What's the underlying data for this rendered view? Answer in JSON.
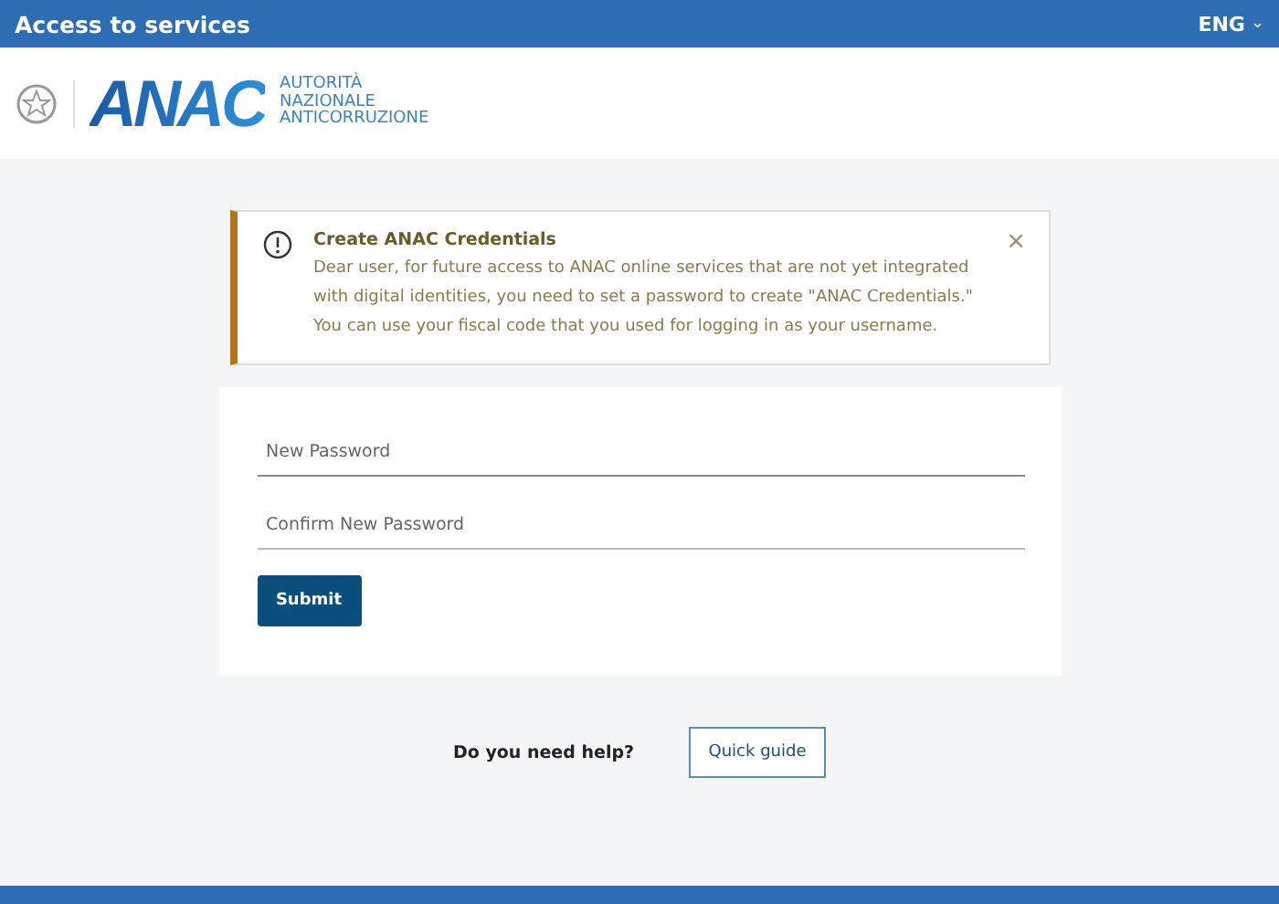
{
  "header": {
    "title": "Access to services",
    "language": "ENG",
    "language_caret": "⌄"
  },
  "brand": {
    "logo_text": "ANAC",
    "tagline": [
      "AUTORITÀ",
      "NAZIONALE",
      "ANTICORRUZIONE"
    ]
  },
  "alert": {
    "title": "Create ANAC Credentials",
    "message": "Dear user, for future access to ANAC online services that are not yet integrated with digital identities, you need to set a password to create \"ANAC Credentials.\" You can use your fiscal code that you used for logging in as your username.",
    "close": "×"
  },
  "form": {
    "fields": [
      {
        "placeholder": "New Password"
      },
      {
        "placeholder": "Confirm New Password"
      }
    ],
    "submit": "Submit"
  },
  "help": {
    "question": "Do you need help?",
    "button": "Quick guide"
  }
}
